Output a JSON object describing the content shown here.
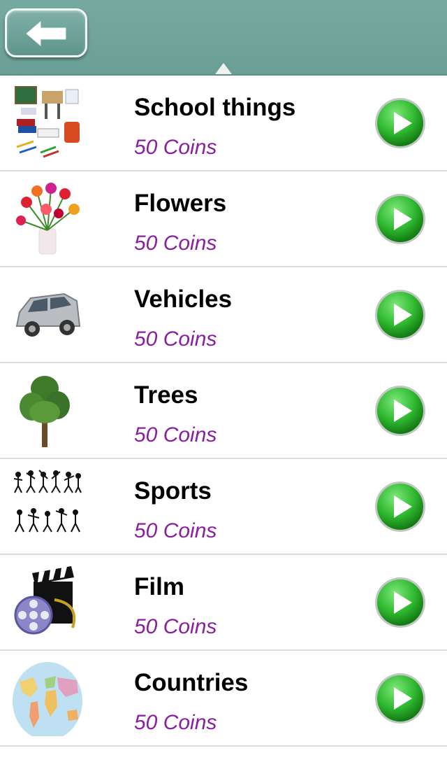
{
  "header": {
    "back_icon": "left-arrow-icon",
    "accent_color": "#6fa39a"
  },
  "categories": [
    {
      "title": "School things",
      "price": "50 Coins",
      "icon": "school-things-image"
    },
    {
      "title": "Flowers",
      "price": "50 Coins",
      "icon": "flowers-image"
    },
    {
      "title": "Vehicles",
      "price": "50 Coins",
      "icon": "car-image"
    },
    {
      "title": "Trees",
      "price": "50 Coins",
      "icon": "tree-image"
    },
    {
      "title": "Sports",
      "price": "50 Coins",
      "icon": "sports-silhouettes-image"
    },
    {
      "title": "Film",
      "price": "50 Coins",
      "icon": "film-reel-clapperboard-image"
    },
    {
      "title": "Countries",
      "price": "50 Coins",
      "icon": "world-map-image"
    }
  ],
  "colors": {
    "price_text": "#8a1ea0",
    "play_button": "#2fb82f",
    "divider": "#dcdcdc"
  }
}
